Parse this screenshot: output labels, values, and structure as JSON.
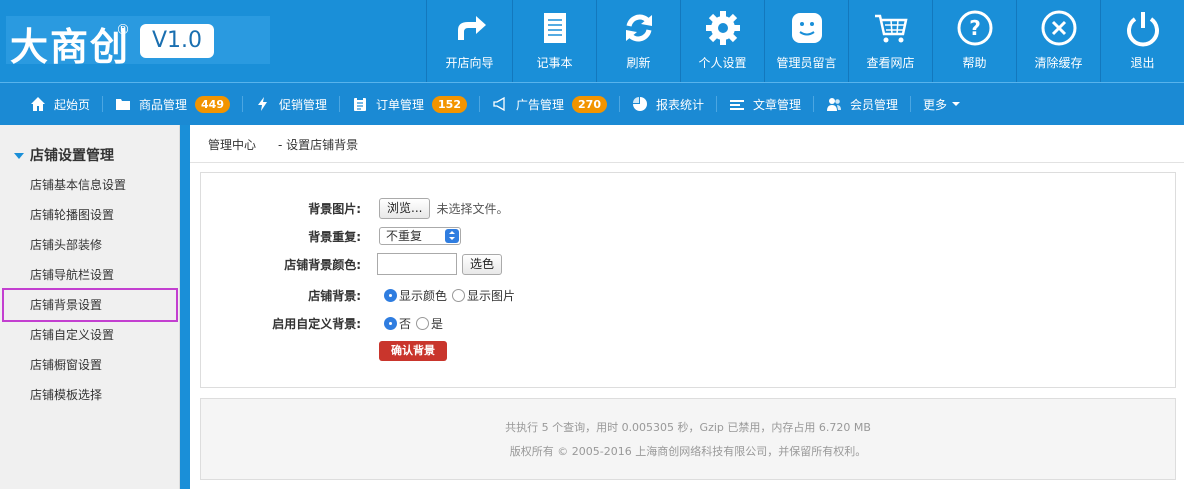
{
  "logo": {
    "text": "大商创",
    "reg": "®",
    "version": "V1.0"
  },
  "topnav": [
    {
      "label": "开店向导",
      "icon": "arrow-forward-icon"
    },
    {
      "label": "记事本",
      "icon": "notepad-icon"
    },
    {
      "label": "刷新",
      "icon": "refresh-icon"
    },
    {
      "label": "个人设置",
      "icon": "gear-icon"
    },
    {
      "label": "管理员留言",
      "icon": "message-icon"
    },
    {
      "label": "查看网店",
      "icon": "cart-icon"
    },
    {
      "label": "帮助",
      "icon": "help-icon"
    },
    {
      "label": "清除缓存",
      "icon": "close-circle-icon"
    },
    {
      "label": "退出",
      "icon": "power-icon"
    }
  ],
  "subnav": [
    {
      "label": "起始页",
      "icon": "home-icon"
    },
    {
      "label": "商品管理",
      "icon": "folder-icon",
      "badge": "449"
    },
    {
      "label": "促销管理",
      "icon": "lightning-icon"
    },
    {
      "label": "订单管理",
      "icon": "clipboard-icon",
      "badge": "152"
    },
    {
      "label": "广告管理",
      "icon": "megaphone-icon",
      "badge": "270"
    },
    {
      "label": "报表统计",
      "icon": "pie-chart-icon"
    },
    {
      "label": "文章管理",
      "icon": "list-icon"
    },
    {
      "label": "会员管理",
      "icon": "users-icon"
    },
    {
      "label": "更多"
    }
  ],
  "sidebar": {
    "title": "店铺设置管理",
    "items": [
      "店铺基本信息设置",
      "店铺轮播图设置",
      "店铺头部装修",
      "店铺导航栏设置",
      "店铺背景设置",
      "店铺自定义设置",
      "店铺橱窗设置",
      "店铺模板选择"
    ],
    "active_index": 4
  },
  "breadcrumb": {
    "root": "管理中心",
    "current": "- 设置店铺背景"
  },
  "form": {
    "bg_image_label": "背景图片:",
    "browse_button": "浏览...",
    "no_file_text": "未选择文件。",
    "bg_repeat_label": "背景重复:",
    "bg_repeat_value": "不重复",
    "bg_color_label": "店铺背景颜色:",
    "bg_color_value": "",
    "pick_color_button": "选色",
    "shop_bg_label": "店铺背景:",
    "shop_bg_opt1": "显示颜色",
    "shop_bg_opt2": "显示图片",
    "custom_bg_label": "启用自定义背景:",
    "custom_bg_opt1": "否",
    "custom_bg_opt2": "是",
    "submit_button": "确认背景"
  },
  "footer": {
    "line1": "共执行 5 个查询，用时 0.005305 秒，Gzip 已禁用，内存占用 6.720 MB",
    "line2": "版权所有 © 2005-2016 上海商创网络科技有限公司，并保留所有权利。"
  },
  "colors": {
    "header_bg": "#1a8fd8",
    "badge": "#f29400",
    "submit": "#c9352c",
    "highlight_border": "#c33fd0"
  }
}
